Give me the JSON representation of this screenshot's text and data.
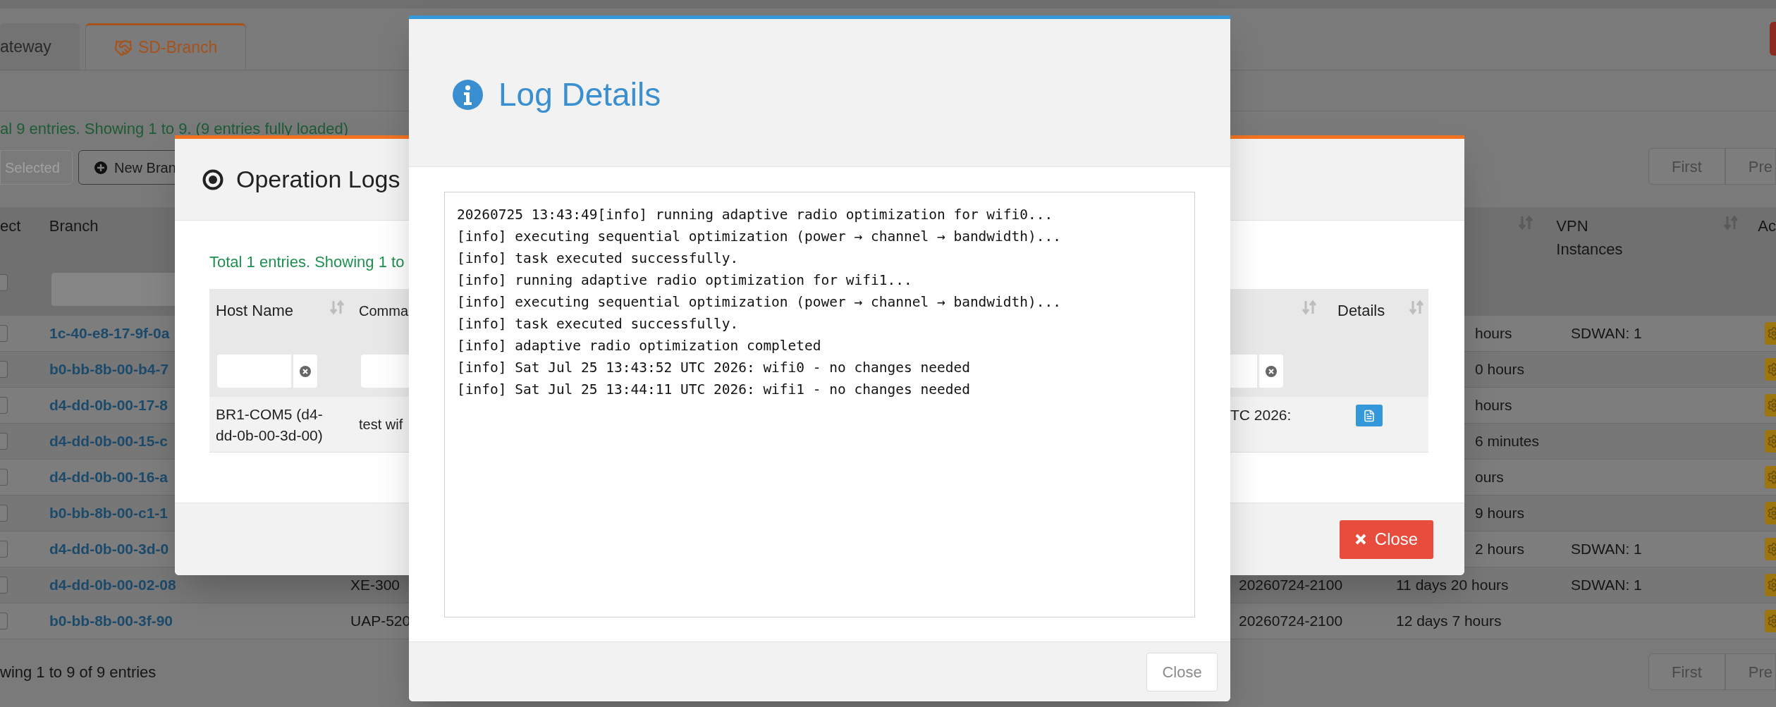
{
  "page": {
    "tabs": [
      {
        "label": "ateway",
        "kind": "plain",
        "selected": false
      },
      {
        "label": "SD-Branch",
        "kind": "branch",
        "selected": true
      }
    ],
    "status": "al 9 entries. Showing 1 to 9. (9 entries fully loaded)",
    "toolbar_buttons": [
      {
        "label": "Selected",
        "kind": "plain",
        "disabled": true
      },
      {
        "label": "New Bran",
        "kind": "add",
        "disabled": false
      }
    ],
    "pagination_top": [
      "First",
      "Pre"
    ],
    "select_all": {
      "checked": false
    },
    "header": {
      "select": "ect",
      "branch": "Branch",
      "vpn": "VPN Instances",
      "action": "Ac"
    },
    "rows": [
      {
        "checked": false,
        "branch": "1c-40-e8-17-9f-0a",
        "uptime": "hours",
        "vpn": "SDWAN: 1"
      },
      {
        "checked": false,
        "branch": "b0-bb-8b-00-b4-7",
        "uptime": "0 hours"
      },
      {
        "checked": false,
        "branch": "d4-dd-0b-00-17-8",
        "uptime": "hours"
      },
      {
        "checked": false,
        "branch": "d4-dd-0b-00-15-c",
        "uptime": "6 minutes"
      },
      {
        "checked": false,
        "branch": "d4-dd-0b-00-16-a",
        "uptime": "ours"
      },
      {
        "checked": false,
        "branch": "b0-bb-8b-00-c1-1",
        "uptime": "9 hours"
      },
      {
        "checked": false,
        "branch": "d4-dd-0b-00-3d-0",
        "uptime": "2 hours",
        "vpn": "SDWAN: 1"
      },
      {
        "checked": false,
        "branch": "d4-dd-0b-00-02-08",
        "model": "XE-300",
        "firmware": "20260724-2100",
        "uptime": "11 days 20 hours",
        "vpn": "SDWAN: 1"
      },
      {
        "checked": false,
        "branch": "b0-bb-8b-00-3f-90",
        "model": "UAP-520",
        "firmware": "20260724-2100",
        "uptime": "12 days 7 hours"
      }
    ],
    "footer": "wing 1 to 9 of 9 entries",
    "pagination_bottom": [
      "First",
      "Pre"
    ]
  },
  "operation_logs": {
    "title": "Operation Logs",
    "summary": "Total 1 entries. Showing 1 to",
    "columns": [
      "Host Name",
      "Comma",
      "Details"
    ],
    "rows": [
      {
        "host": "BR1-COM5 (d4-dd-0b-00-3d-00)",
        "command": "test wif",
        "column_3": "TC 2026:"
      }
    ],
    "close": "Close"
  },
  "log_details": {
    "title": "Log Details",
    "lines": [
      "20260725 13:43:49[info] running adaptive radio optimization for wifi0...",
      "[info] executing sequential optimization (power → channel → bandwidth)...",
      "[info] task executed successfully.",
      "[info] running adaptive radio optimization for wifi1...",
      "[info] executing sequential optimization (power → channel → bandwidth)...",
      "[info] task executed successfully.",
      "[info] adaptive radio optimization completed",
      "[info] Sat Jul 25 13:43:52 UTC 2026: wifi0 - no changes needed",
      "[info] Sat Jul 25 13:44:11 UTC 2026: wifi1 - no changes needed"
    ],
    "close": "Close"
  }
}
